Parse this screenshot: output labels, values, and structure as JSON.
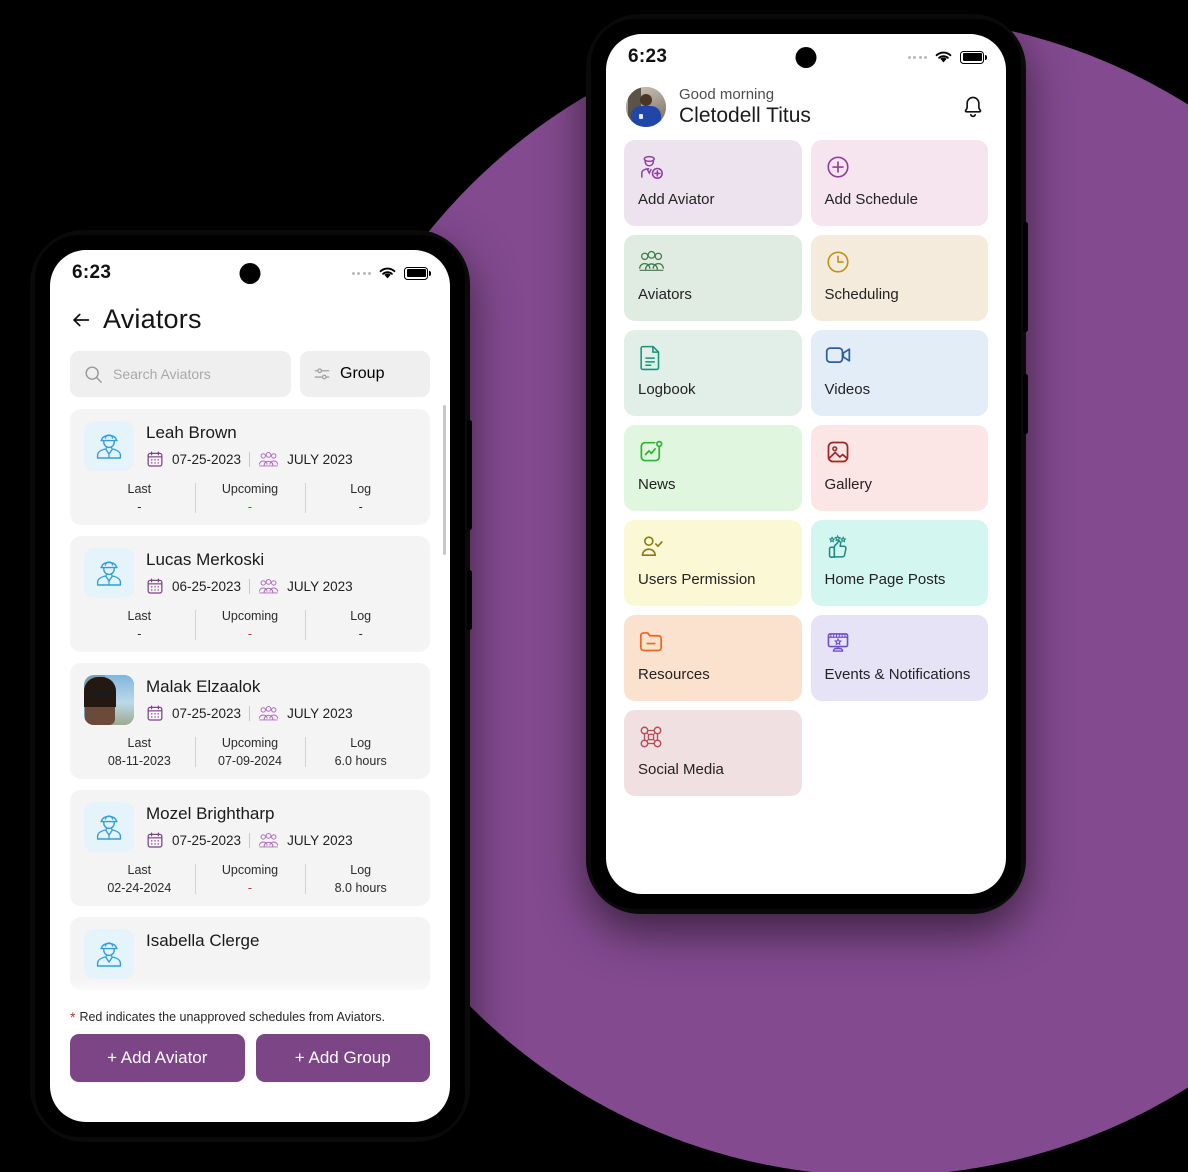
{
  "home": {
    "status": {
      "time": "6:23",
      "wifi_icon": "wifi-icon",
      "battery_icon": "battery-icon",
      "signal_icon": "signal-dots-icon"
    },
    "greeting_small": "Good morning",
    "user_name": "Cletodell Titus",
    "bell_icon": "notification-bell-icon",
    "tiles": [
      {
        "label": "Add Aviator",
        "icon": "add-aviator-icon",
        "bg": "#ede3ee",
        "fg": "#8e3f9e"
      },
      {
        "label": "Add Schedule",
        "icon": "plus-circle-icon",
        "bg": "#f6e4ef",
        "fg": "#8e3f9e"
      },
      {
        "label": "Aviators",
        "icon": "people-group-icon",
        "bg": "#e0ece2",
        "fg": "#3f7a46"
      },
      {
        "label": "Scheduling",
        "icon": "clock-icon",
        "bg": "#f4ebdd",
        "fg": "#c29212"
      },
      {
        "label": "Logbook",
        "icon": "document-lines-icon",
        "bg": "#e2efe9",
        "fg": "#13967a"
      },
      {
        "label": "Videos",
        "icon": "video-camera-icon",
        "bg": "#e3edf8",
        "fg": "#2b5f9e"
      },
      {
        "label": "News",
        "icon": "news-chart-icon",
        "bg": "#e0f6df",
        "fg": "#2db52d"
      },
      {
        "label": "Gallery",
        "icon": "image-icon",
        "bg": "#fbe6e5",
        "fg": "#a02626"
      },
      {
        "label": "Users Permission",
        "icon": "user-check-icon",
        "bg": "#fbf8d6",
        "fg": "#8a7a12"
      },
      {
        "label": "Home Page Posts",
        "icon": "thumbs-up-stars-icon",
        "bg": "#d4f6f1",
        "fg": "#1a8b80"
      },
      {
        "label": "Resources",
        "icon": "folder-minus-icon",
        "bg": "#fbe2cf",
        "fg": "#f2641e"
      },
      {
        "label": "Events & Notifications",
        "icon": "events-board-icon",
        "bg": "#e7e3f7",
        "fg": "#6f4fc9"
      },
      {
        "label": "Social Media",
        "icon": "social-network-icon",
        "bg": "#f1e0e2",
        "fg": "#b84a58"
      }
    ]
  },
  "aviators": {
    "status": {
      "time": "6:23",
      "wifi_icon": "wifi-icon",
      "battery_icon": "battery-icon",
      "signal_icon": "signal-dots-icon"
    },
    "back_icon": "back-arrow-icon",
    "title": "Aviators",
    "search": {
      "placeholder": "Search Aviators",
      "icon": "search-icon"
    },
    "group_button": {
      "label": "Group",
      "icon": "filter-sliders-icon"
    },
    "stat_labels": {
      "last": "Last",
      "upcoming": "Upcoming",
      "log": "Log"
    },
    "cards": [
      {
        "name": "Leah Brown",
        "date": "07-25-2023",
        "group": "JULY 2023",
        "last": "-",
        "upcoming": "-",
        "log": "-",
        "upcoming_red": true,
        "avatar": "pilot-icon"
      },
      {
        "name": "Lucas Merkoski",
        "date": "06-25-2023",
        "group": "JULY 2023",
        "last": "-",
        "upcoming": "-",
        "log": "-",
        "upcoming_red": true,
        "avatar": "pilot-icon"
      },
      {
        "name": "Malak Elzaalok",
        "date": "07-25-2023",
        "group": "JULY 2023",
        "last": "08-11-2023",
        "upcoming": "07-09-2024",
        "log": "6.0 hours",
        "upcoming_red": false,
        "avatar": "photo"
      },
      {
        "name": "Mozel Brightharp",
        "date": "07-25-2023",
        "group": "JULY 2023",
        "last": "02-24-2024",
        "upcoming": "-",
        "log": "8.0 hours",
        "upcoming_red": true,
        "avatar": "pilot-icon"
      },
      {
        "name": "Isabella Clerge",
        "date": "",
        "group": "",
        "last": "",
        "upcoming": "",
        "log": "",
        "upcoming_red": false,
        "avatar": "pilot-icon"
      }
    ],
    "footnote": {
      "star": "*",
      "text": "Red indicates the unapproved schedules from Aviators."
    },
    "add_aviator_button": "+  Add Aviator",
    "add_group_button": "+  Add Group"
  },
  "theme": {
    "purple_backdrop": "#834a8f",
    "button_purple": "#7c4585",
    "red": "#d62b2b"
  }
}
